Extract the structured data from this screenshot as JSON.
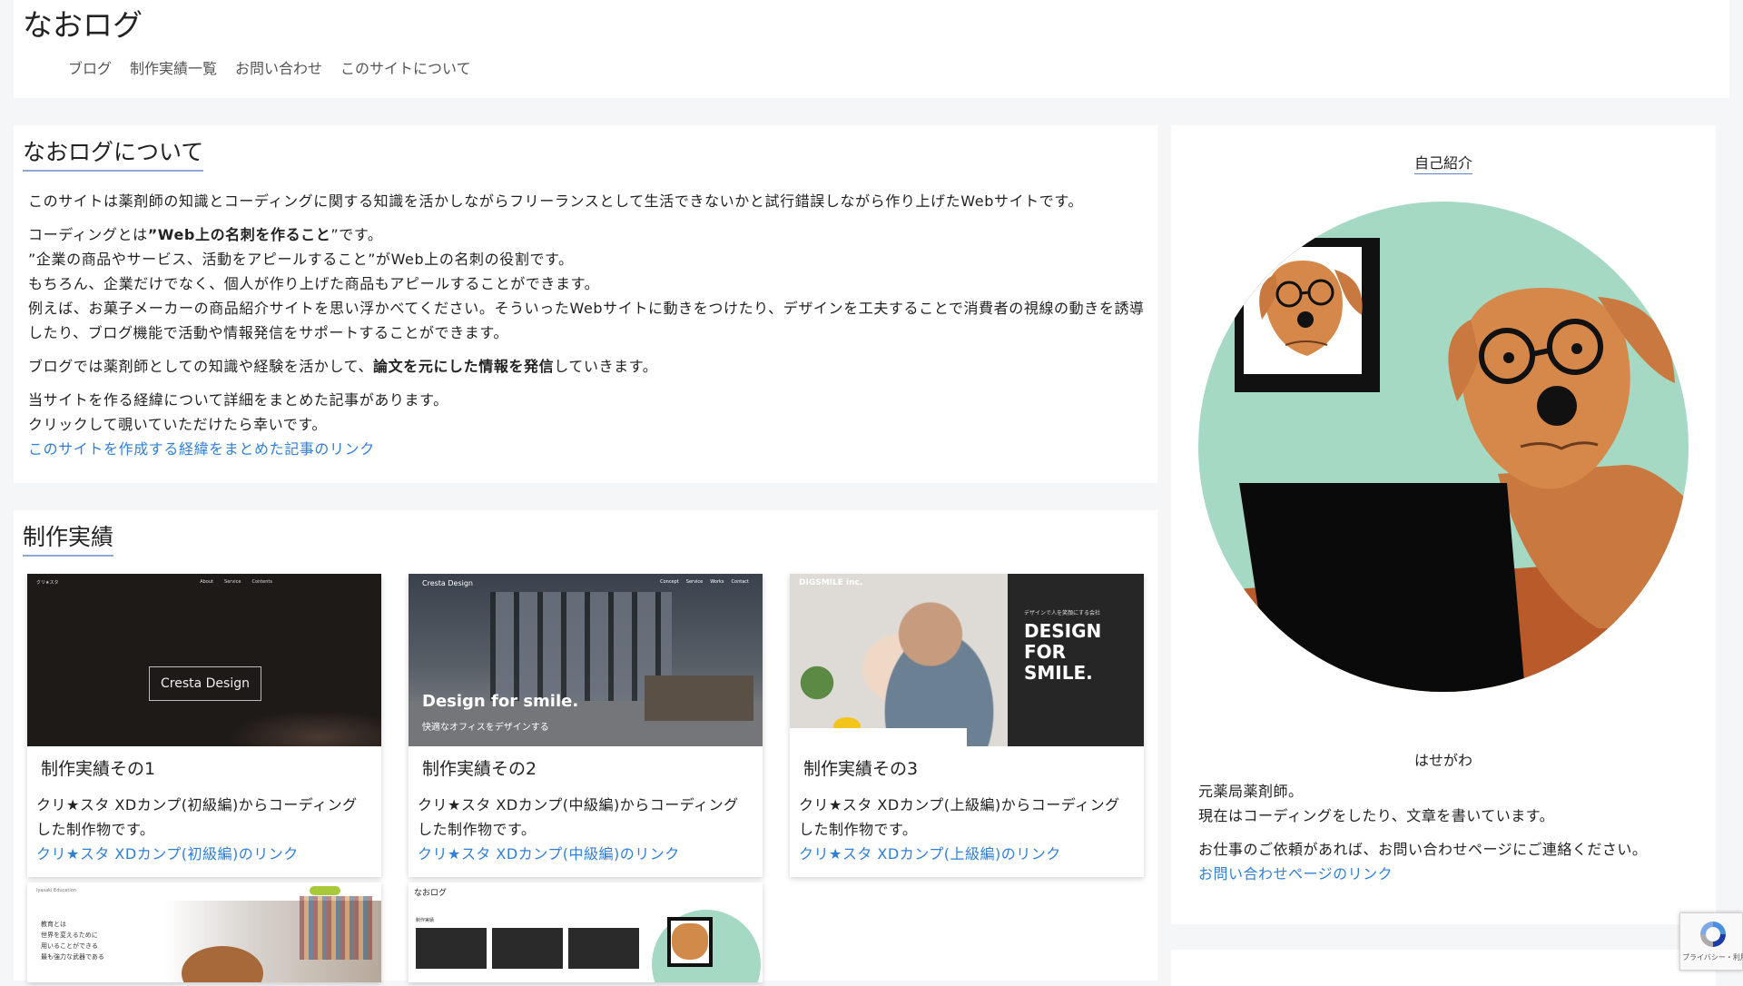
{
  "header": {
    "site_title": "なおログ",
    "nav": [
      "ブログ",
      "制作実績一覧",
      "お問い合わせ",
      "このサイトについて"
    ]
  },
  "about": {
    "heading": "なおログについて",
    "p1": "このサイトは薬剤師の知識とコーディングに関する知識を活かしながらフリーランスとして生活できないかと試行錯誤しながら作り上げたWebサイトです。",
    "p2_prefix": "コーディングとは",
    "p2_bold": "”Web上の名刺を作ること",
    "p2_suffix": "”です。",
    "p2_line2": "”企業の商品やサービス、活動をアピールすること”がWeb上の名刺の役割です。",
    "p2_line3": "もちろん、企業だけでなく、個人が作り上げた商品もアピールすることができます。",
    "p2_line4": "例えば、お菓子メーカーの商品紹介サイトを思い浮かべてください。そういったWebサイトに動きをつけたり、デザインを工夫することで消費者の視線の動きを誘導したり、ブログ機能で活動や情報発信をサポートすることができます。",
    "p3_prefix": "ブログでは薬剤師としての知識や経験を活かして、",
    "p3_bold": "論文を元にした情報を発信",
    "p3_suffix": "していきます。",
    "p4_line1": "当サイトを作る経緯について詳細をまとめた記事があります。",
    "p4_line2": "クリックして覗いていただけたら幸いです。",
    "p4_link": "このサイトを作成する経緯をまとめた記事のリンク"
  },
  "works": {
    "heading": "制作実績",
    "items": [
      {
        "title": "制作実績その1",
        "desc": "クリ★スタ XDカンプ(初級編)からコーディングした制作物です。",
        "link": "クリ★スタ XDカンプ(初級編)のリンク",
        "thumb_text": "Cresta Design",
        "thumb_logo": "クリ★スタ",
        "thumb_nav": [
          "About",
          "Service",
          "Contents"
        ]
      },
      {
        "title": "制作実績その2",
        "desc": "クリ★スタ XDカンプ(中級編)からコーディングした制作物です。",
        "link": "クリ★スタ XDカンプ(中級編)のリンク",
        "thumb_logo": "Cresta Design",
        "thumb_tagline": "Design for smile.",
        "thumb_sub": "快適なオフィスをデザインする",
        "thumb_nav": [
          "Concept",
          "Service",
          "Works",
          "Contact"
        ]
      },
      {
        "title": "制作実績その3",
        "desc": "クリ★スタ XDカンプ(上級編)からコーディングした制作物です。",
        "link": "クリ★スタ XDカンプ(上級編)のリンク",
        "thumb_brand": "DIGSMILE inc.",
        "thumb_kicker": "デザインで人を笑顔にする会社",
        "thumb_headline": [
          "DESIGN",
          "FOR",
          "SMILE."
        ]
      }
    ],
    "lower": [
      {
        "thumb_logo": "Iyasaki Education",
        "thumb_copy": [
          "教育とは",
          "世界を変えるために",
          "用いることができる",
          "最も強力な武器である"
        ]
      },
      {
        "thumb_title": "なおログ",
        "thumb_section": "制作実績"
      }
    ]
  },
  "sidebar": {
    "title": "自己紹介",
    "name": "はせがわ",
    "line1": "元薬局薬剤師。",
    "line2": "現在はコーディングをしたり、文章を書いています。",
    "line3": "お仕事のご依頼があれば、お問い合わせページにご連絡ください。",
    "link": "お問い合わせページのリンク"
  },
  "recaptcha": {
    "text": "プライバシー・利用規約"
  },
  "colors": {
    "link": "#2f7fd8",
    "avatar_bg": "#a5d9c4",
    "dog": "#d6884a",
    "table": "#b85a2a"
  }
}
